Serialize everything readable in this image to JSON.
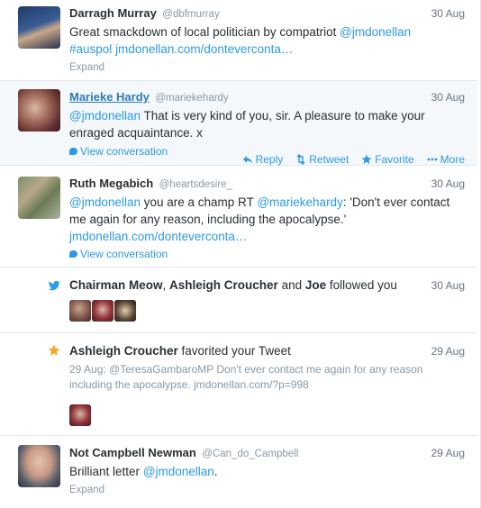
{
  "tweets": [
    {
      "name": "Darragh Murray",
      "handle": "@dbfmurray",
      "time": "30 Aug",
      "text_plain": "Great smackdown of local politician by compatriot ",
      "mention": "@jmdonellan",
      "hashtag": "#auspol",
      "url": "jmdonellan.com/donteverconta…",
      "expand": "Expand"
    },
    {
      "name": "Marieke Hardy",
      "handle": "@mariekehardy",
      "time": "30 Aug",
      "mention": "@jmdonellan",
      "text_plain": " That is very kind of you, sir. A pleasure to make your enraged acquaintance. x",
      "view_conversation": "View conversation",
      "actions": {
        "reply": "Reply",
        "retweet": "Retweet",
        "favorite": "Favorite",
        "more": "More"
      }
    },
    {
      "name": "Ruth Megabich",
      "handle": "@heartsdesire_",
      "time": "30 Aug",
      "mention": "@jmdonellan",
      "text_a": " you are a champ RT ",
      "mention2": "@mariekehardy",
      "text_b": ": 'Don't ever contact me again for any reason, including the apocalypse.'",
      "url": "jmdonellan.com/donteverconta…",
      "view_conversation": "View conversation"
    }
  ],
  "follow_activity": {
    "user1": "Chairman Meow",
    "sep": ", ",
    "user2": "Ashleigh Croucher",
    "and": " and ",
    "user3": "Joe",
    "suffix": " followed you",
    "time": "30 Aug"
  },
  "favorite_activity": {
    "user": "Ashleigh Croucher",
    "suffix": " favorited your Tweet",
    "time": "29 Aug",
    "quoted": "29 Aug: @TeresaGambaroMP Don't ever contact me again for any reason including the apocalypse. jmdonellan.com/?p=998"
  },
  "last_tweet": {
    "name": "Not Campbell Newman",
    "handle": "@Can_do_Campbell",
    "time": "29 Aug",
    "text_plain": "Brilliant letter ",
    "mention": "@jmdonellan",
    "text_end": ".",
    "expand": "Expand"
  },
  "colors": {
    "link": "#2b9ae8",
    "muted": "#8899a6",
    "hover_bg": "#f5f8fa",
    "favorite_star": "#f5a623",
    "bird": "#2b9ae8"
  },
  "icons": [
    "reply-icon",
    "retweet-icon",
    "favorite-icon",
    "more-icon",
    "conversation-icon",
    "twitter-bird-icon",
    "star-icon"
  ]
}
